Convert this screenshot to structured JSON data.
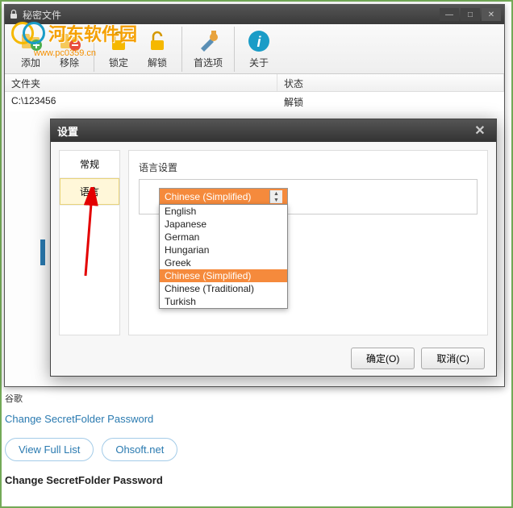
{
  "main_window": {
    "title": "秘密文件",
    "toolbar": {
      "add": "添加",
      "remove": "移除",
      "lock": "锁定",
      "unlock": "解锁",
      "options": "首选项",
      "about": "关于"
    },
    "columns": {
      "folder": "文件夹",
      "status": "状态"
    },
    "rows": [
      {
        "folder": "C:\\123456",
        "status": "解锁"
      }
    ]
  },
  "watermark": {
    "brand": "河东软件园",
    "url": "www.pc0359.cn"
  },
  "dialog": {
    "title": "设置",
    "tabs": {
      "general": "常规",
      "language": "语言"
    },
    "section_label": "语言设置",
    "selected_language": "Chinese (Simplified)",
    "languages": [
      "English",
      "Japanese",
      "German",
      "Hungarian",
      "Greek",
      "Chinese (Simplified)",
      "Chinese (Traditional)",
      "Turkish"
    ],
    "highlighted_index": 5,
    "ok_label": "确定(O)",
    "cancel_label": "取消(C)"
  },
  "bottom": {
    "small": "谷歌",
    "link1": "Change SecretFolder Password",
    "btn_view": "View Full List",
    "btn_ohsoft": "Ohsoft.net",
    "bold_label": "Change SecretFolder Password"
  }
}
